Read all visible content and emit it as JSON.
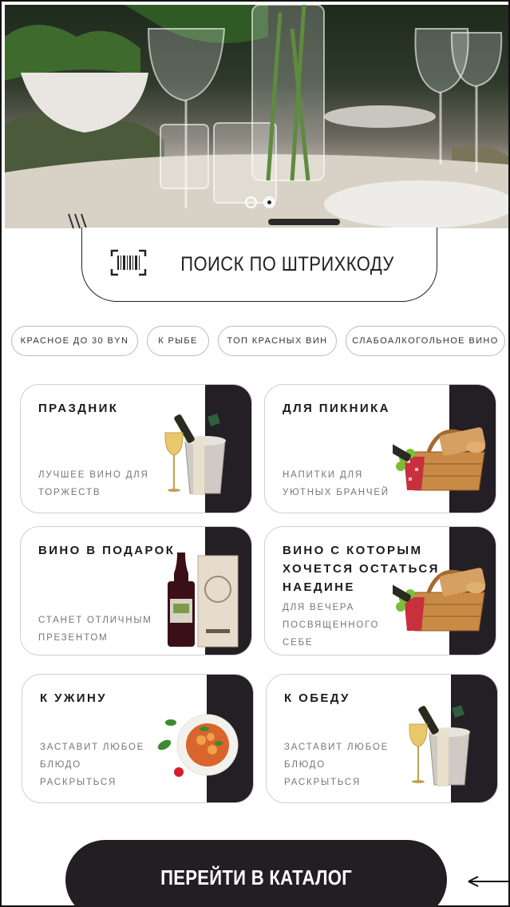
{
  "hero": {
    "slide_count": 2,
    "active_slide": 2
  },
  "barcode_search": {
    "label": "ПОИСК ПО ШТРИХКОДУ",
    "icon": "barcode-scan-icon"
  },
  "chips": [
    {
      "label": "КРАСНОЕ ДО 30 BYN"
    },
    {
      "label": "К РЫБЕ"
    },
    {
      "label": "ТОП КРАСНЫХ ВИН"
    },
    {
      "label": "СЛАБОАЛКОГОЛЬНОЕ ВИНО"
    }
  ],
  "cards": [
    {
      "title": "ПРАЗДНИК",
      "subtitle": [
        "ЛУЧШЕЕ ВИНО ДЛЯ",
        "ТОРЖЕСТВ"
      ],
      "image": "champagne-bucket-image"
    },
    {
      "title": "ДЛЯ ПИКНИКА",
      "subtitle": [
        "НАПИТКИ ДЛЯ",
        "УЮТНЫХ БРАНЧЕЙ"
      ],
      "image": "picnic-basket-image"
    },
    {
      "title": "ВИНО В ПОДАРОК",
      "subtitle": [
        "СТАНЕТ ОТЛИЧНЫМ",
        "ПРЕЗЕНТОМ"
      ],
      "image": "wine-gift-box-image"
    },
    {
      "title": [
        "ВИНО С КОТОРЫМ",
        "ХОЧЕТСЯ ОСТАТЬСЯ",
        "НАЕДИНЕ"
      ],
      "subtitle": [
        "ДЛЯ ВЕЧЕРА",
        "ПОСВЯЩЕННОГО",
        "СЕБЕ"
      ],
      "image": "picnic-basket-image"
    },
    {
      "title": "К УЖИНУ",
      "subtitle": [
        "ЗАСТАВИТ ЛЮБОЕ",
        "БЛЮДО",
        "РАСКРЫТЬСЯ"
      ],
      "image": "pasta-plate-image"
    },
    {
      "title": "К ОБЕДУ",
      "subtitle": [
        "ЗАСТАВИТ ЛЮБОЕ",
        "БЛЮДО",
        "РАСКРЫТЬСЯ"
      ],
      "image": "champagne-bucket-image"
    }
  ],
  "cta": {
    "label": "ПЕРЕЙТИ В КАТАЛОГ"
  },
  "colors": {
    "dark": "#231f24",
    "border": "#cfcfcf",
    "muted_text": "#777777"
  }
}
